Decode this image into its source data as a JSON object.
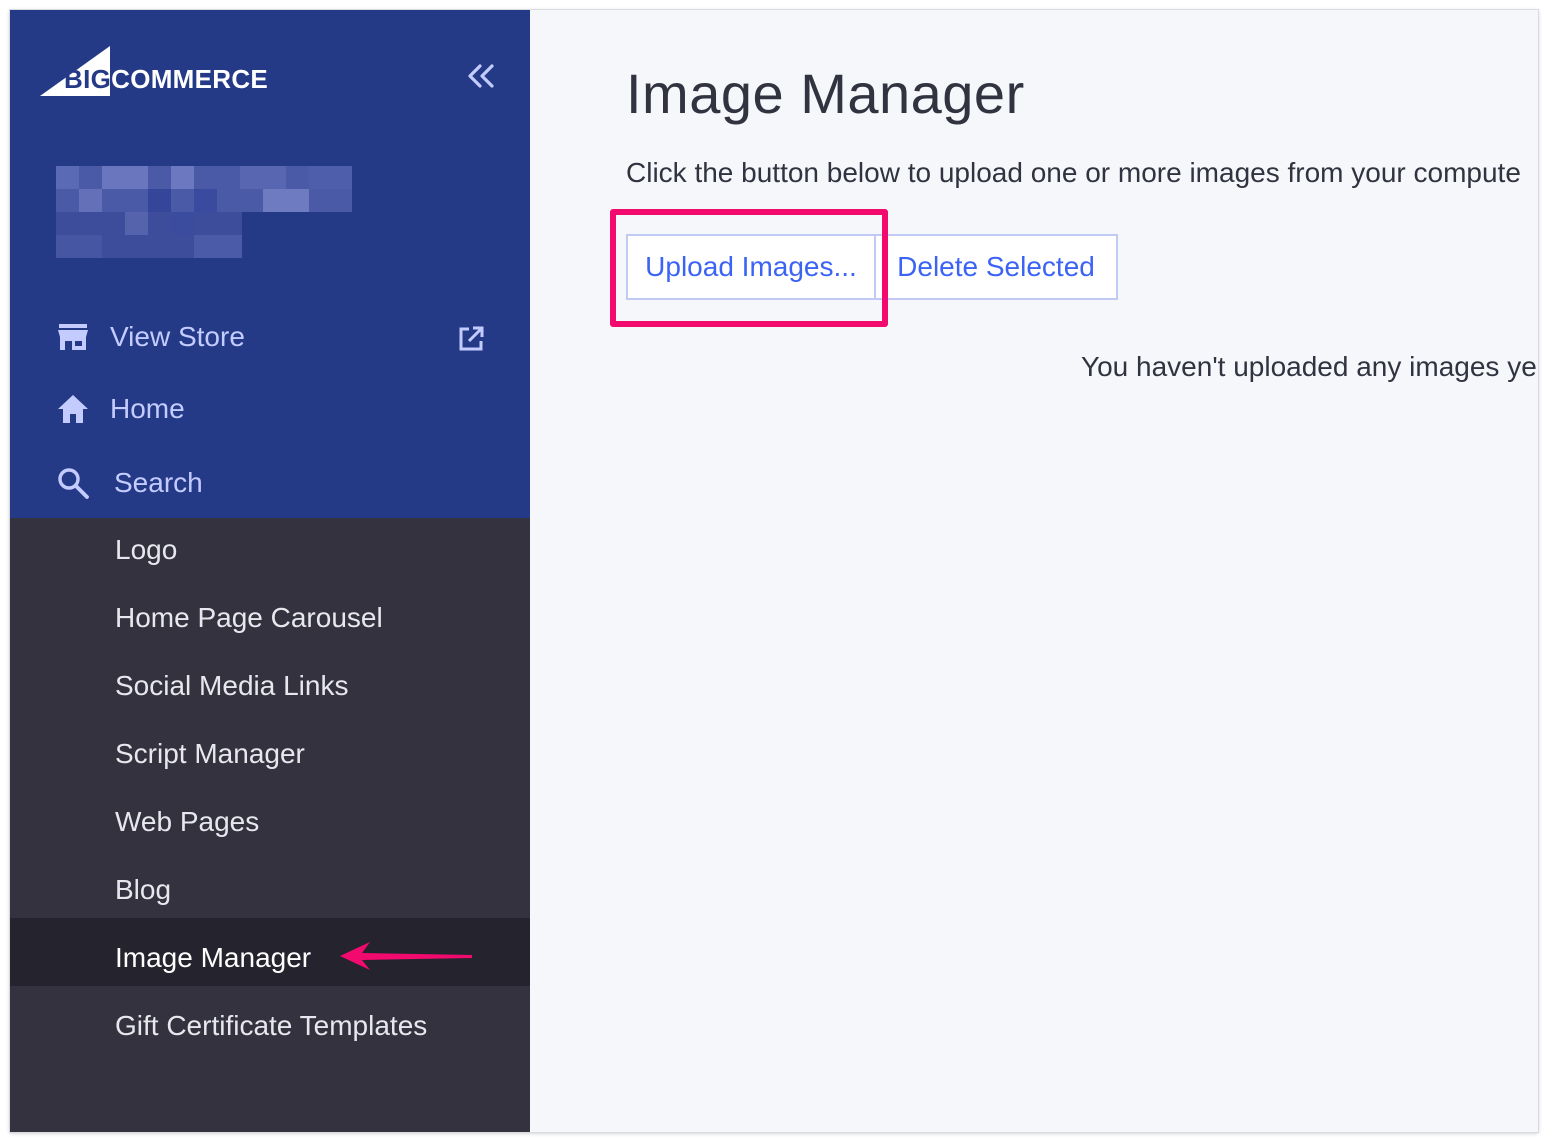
{
  "brand": {
    "logo_big": "BIG",
    "logo_rest": "COMMERCE"
  },
  "sidebar": {
    "collapse_icon": "double-chevron-left-icon",
    "primary": [
      {
        "label": "View Store",
        "icon": "storefront-icon",
        "action_icon": "external-link-icon"
      },
      {
        "label": "Home",
        "icon": "home-icon"
      },
      {
        "label": "Search",
        "icon": "search-icon"
      }
    ],
    "sub_items": [
      {
        "label": "Logo"
      },
      {
        "label": "Home Page Carousel"
      },
      {
        "label": "Social Media Links"
      },
      {
        "label": "Script Manager"
      },
      {
        "label": "Web Pages"
      },
      {
        "label": "Blog"
      },
      {
        "label": "Image Manager",
        "active": true
      },
      {
        "label": "Gift Certificate Templates"
      }
    ]
  },
  "main": {
    "title": "Image Manager",
    "instructions": "Click the button below to upload one or more images from your compute",
    "upload_button": "Upload Images...",
    "delete_button": "Delete Selected",
    "empty_message": "You haven't uploaded any images ye"
  },
  "colors": {
    "sidebar_top": "#253a87",
    "sidebar_bottom": "#33323e",
    "accent": "#3c64f4",
    "annotation": "#f20a6e"
  }
}
